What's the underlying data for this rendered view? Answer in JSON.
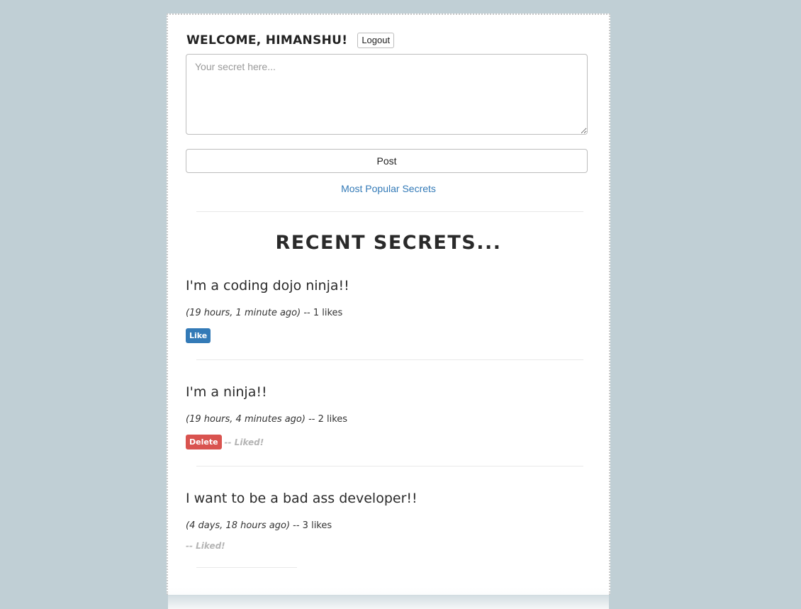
{
  "header": {
    "welcome_text": "WELCOME, HIMANSHU!",
    "logout_label": "Logout"
  },
  "composer": {
    "placeholder": "Your secret here...",
    "value": "",
    "post_label": "Post"
  },
  "popular_link": "Most Popular Secrets",
  "recent_title": "RECENT SECRETS...",
  "secrets": [
    {
      "text": "I'm a coding dojo ninja!!",
      "ago": "(19 hours, 1 minute ago)",
      "likes": " -- 1 likes",
      "action_label": "Like",
      "liked_label": ""
    },
    {
      "text": "I'm a ninja!!",
      "ago": "(19 hours, 4 minutes ago)",
      "likes": " -- 2 likes",
      "action_label": "Delete",
      "liked_label": "-- Liked!"
    },
    {
      "text": "I want to be a bad ass developer!!",
      "ago": "(4 days, 18 hours ago)",
      "likes": " -- 3 likes",
      "action_label": "",
      "liked_label": "-- Liked!"
    }
  ],
  "colors": {
    "background": "#c0cfd5",
    "link": "#337ab7",
    "like_button": "#337ab7",
    "delete_button": "#d9534f",
    "liked_text": "#b5b5b5"
  }
}
